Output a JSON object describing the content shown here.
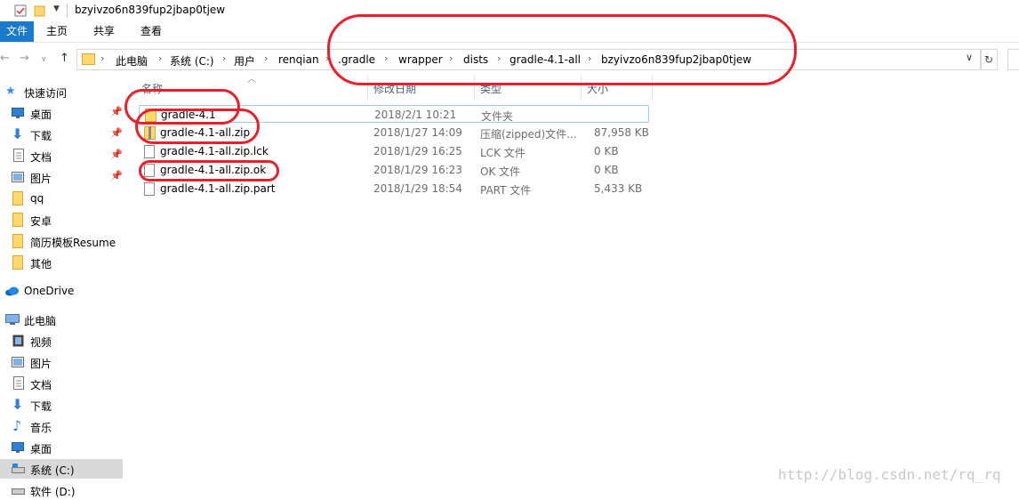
{
  "window": {
    "title": "bzyivzo6n839fup2jbap0tjew"
  },
  "ribbon": {
    "tabs": [
      "文件",
      "主页",
      "共享",
      "查看"
    ]
  },
  "nav": {
    "back": "←",
    "forward": "→",
    "up": "↑",
    "dropdown": "∨",
    "refresh": "↻",
    "breadcrumbs": [
      "此电脑",
      "系统 (C:)",
      "用户",
      "renqian",
      ".gradle",
      "wrapper",
      "dists",
      "gradle-4.1-all",
      "bzyivzo6n839fup2jbap0tjew"
    ]
  },
  "sidebar": {
    "items": [
      {
        "label": "快速访问",
        "icon": "star-icon"
      },
      {
        "label": "桌面",
        "icon": "desktop-icon",
        "pinned": true
      },
      {
        "label": "下载",
        "icon": "download-icon",
        "pinned": true
      },
      {
        "label": "文档",
        "icon": "document-icon",
        "pinned": true
      },
      {
        "label": "图片",
        "icon": "picture-icon",
        "pinned": true
      },
      {
        "label": "qq",
        "icon": "folder-icon"
      },
      {
        "label": "安卓",
        "icon": "folder-icon"
      },
      {
        "label": "简历模板Resume",
        "icon": "folder-icon"
      },
      {
        "label": "其他",
        "icon": "folder-icon"
      },
      {
        "label": "OneDrive",
        "icon": "cloud-icon"
      },
      {
        "label": "此电脑",
        "icon": "computer-icon"
      },
      {
        "label": "视频",
        "icon": "video-icon"
      },
      {
        "label": "图片",
        "icon": "picture-icon"
      },
      {
        "label": "文档",
        "icon": "document-icon"
      },
      {
        "label": "下载",
        "icon": "download-icon"
      },
      {
        "label": "音乐",
        "icon": "music-icon"
      },
      {
        "label": "桌面",
        "icon": "desktop-icon"
      },
      {
        "label": "系统 (C:)",
        "icon": "drive-icon",
        "selected": true
      },
      {
        "label": "软件 (D:)",
        "icon": "drive-icon"
      }
    ]
  },
  "columns": [
    "名称",
    "修改日期",
    "类型",
    "大小"
  ],
  "files": [
    {
      "name": "gradle-4.1",
      "date": "2018/2/1 10:21",
      "type": "文件夹",
      "size": "",
      "icon": "folder-icon"
    },
    {
      "name": "gradle-4.1-all.zip",
      "date": "2018/1/27 14:09",
      "type": "压缩(zipped)文件...",
      "size": "87,958 KB",
      "icon": "zip-icon"
    },
    {
      "name": "gradle-4.1-all.zip.lck",
      "date": "2018/1/29 16:25",
      "type": "LCK 文件",
      "size": "0 KB",
      "icon": "file-icon"
    },
    {
      "name": "gradle-4.1-all.zip.ok",
      "date": "2018/1/29 16:23",
      "type": "OK 文件",
      "size": "0 KB",
      "icon": "file-icon"
    },
    {
      "name": "gradle-4.1-all.zip.part",
      "date": "2018/1/29 18:54",
      "type": "PART 文件",
      "size": "5,433 KB",
      "icon": "file-icon"
    }
  ],
  "watermark": "http://blog.csdn.net/rq_rq",
  "colors": {
    "accent": "#1979ca",
    "annotation": "#e8202a",
    "folder": "#ffd96c",
    "selection": "#99d1ff"
  }
}
